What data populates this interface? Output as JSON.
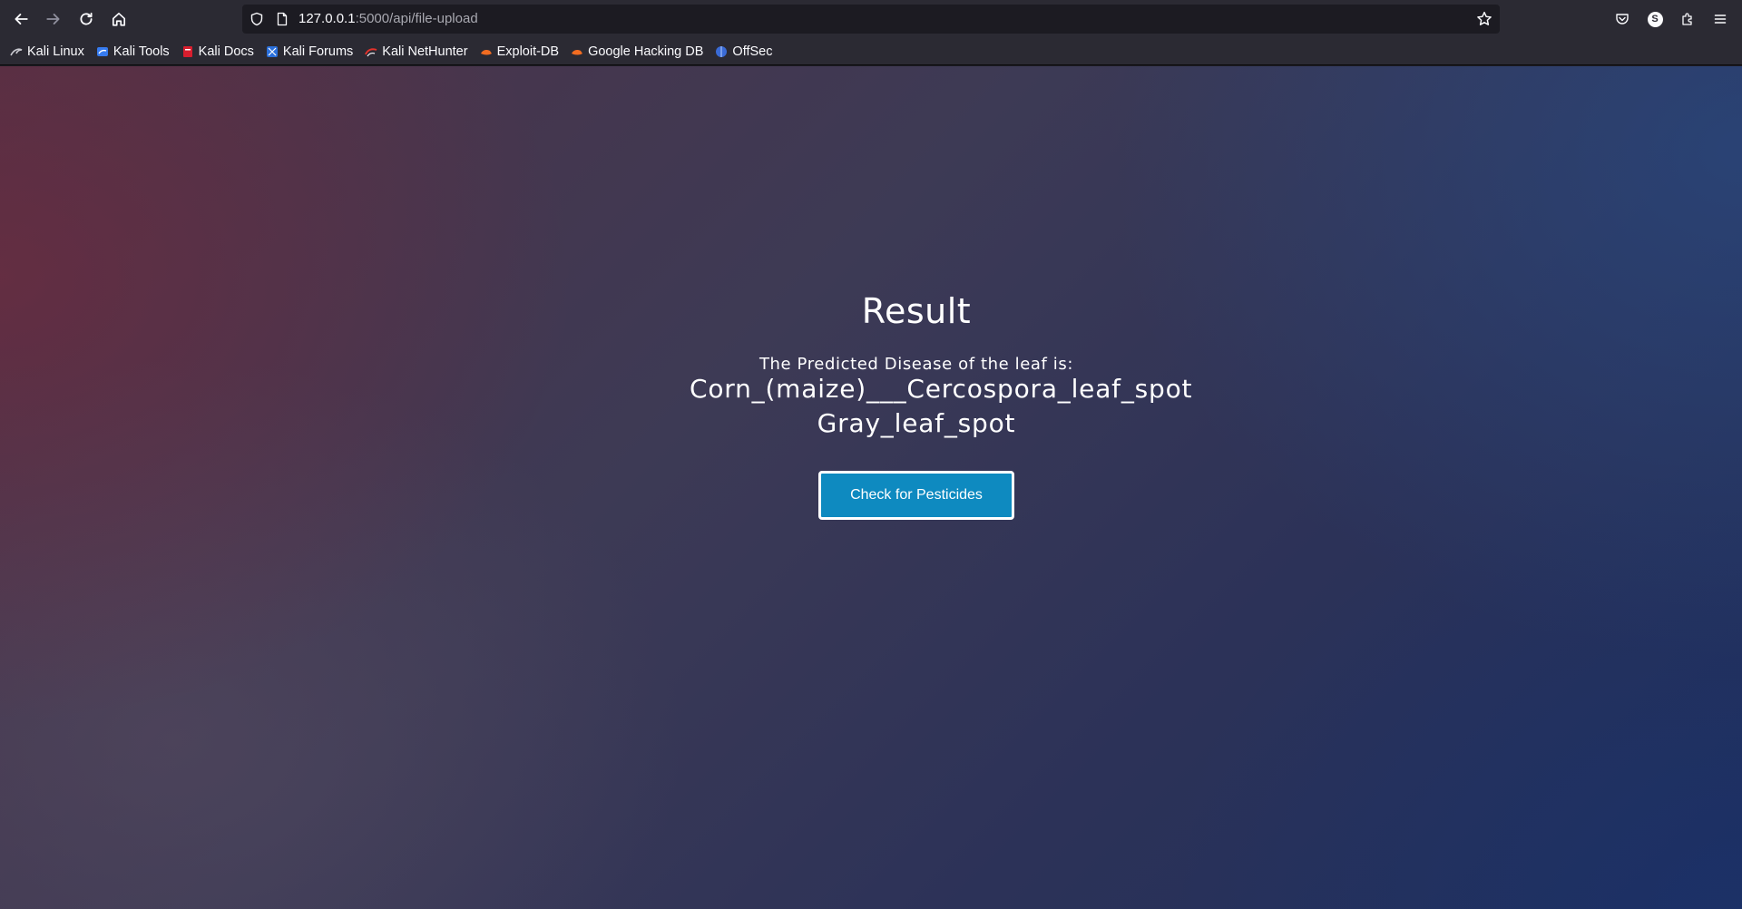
{
  "browser": {
    "url_host": "127.0.0.1",
    "url_path": ":5000/api/file-upload",
    "nav_icons": [
      "back-icon",
      "forward-icon",
      "reload-icon",
      "home-icon"
    ],
    "right_icons": [
      "pocket-icon",
      "account-icon",
      "extensions-icon",
      "menu-icon"
    ],
    "account_initial": "S"
  },
  "bookmarks": [
    {
      "label": "Kali Linux",
      "icon": "kali-linux-icon"
    },
    {
      "label": "Kali Tools",
      "icon": "kali-tools-icon"
    },
    {
      "label": "Kali Docs",
      "icon": "kali-docs-icon"
    },
    {
      "label": "Kali Forums",
      "icon": "kali-forums-icon"
    },
    {
      "label": "Kali NetHunter",
      "icon": "kali-nethunter-icon"
    },
    {
      "label": "Exploit-DB",
      "icon": "exploit-db-icon"
    },
    {
      "label": "Google Hacking DB",
      "icon": "ghdb-icon"
    },
    {
      "label": "OffSec",
      "icon": "offsec-icon"
    }
  ],
  "page": {
    "title": "Result",
    "predict_label": "The Predicted Disease of the leaf is:",
    "disease_line1": "Corn_(maize)___Cercospora_leaf_spot",
    "disease_line2": "Gray_leaf_spot",
    "button_label": "Check for Pesticides"
  },
  "colors": {
    "button_bg": "#0e8ac0",
    "chrome_bg": "#2b2a33",
    "urlbar_bg": "#1c1b22"
  }
}
